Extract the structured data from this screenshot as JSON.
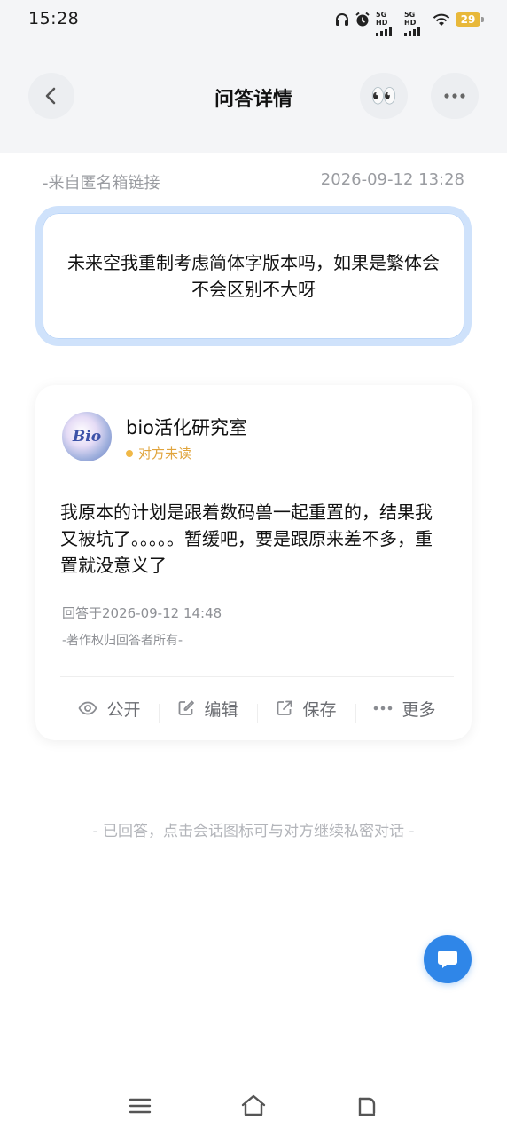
{
  "status_bar": {
    "time": "15:28",
    "network_1": "5G HD",
    "network_2": "5G HD",
    "battery": "29"
  },
  "header": {
    "title": "问答详情",
    "back_icon": "chevron-left-icon",
    "eyes_icon": "eyes-emoji-icon",
    "eyes_emoji": "👀",
    "more_icon": "more-horizontal-icon"
  },
  "meta": {
    "source": "-来自匿名箱链接",
    "time": "2026-09-12 13:28"
  },
  "question": {
    "text": "未来空我重制考虑简体字版本吗，如果是繁体会不会区别不大呀",
    "border_color": "#cfe2fb"
  },
  "answer": {
    "author": "bio活化研究室",
    "avatar_text": "Bio",
    "read_status": "对方未读",
    "text": "我原本的计划是跟着数码兽一起重置的，结果我又被坑了。。。。。暂缓吧，要是跟原来差不多，重置就没意义了",
    "answered_time": "回答于2026-09-12 14:48",
    "copyright": "-著作权归回答者所有-",
    "actions": [
      {
        "label": "公开",
        "icon": "eye-icon"
      },
      {
        "label": "编辑",
        "icon": "edit-icon"
      },
      {
        "label": "保存",
        "icon": "share-export-icon"
      },
      {
        "label": "更多",
        "icon": "more-horizontal-icon"
      }
    ]
  },
  "footer_note": "- 已回答，点击会话图标可与对方继续私密对话 -",
  "colors": {
    "accent": "#2f86e8",
    "unread": "#f0b847",
    "muted": "#9a9ca1"
  }
}
